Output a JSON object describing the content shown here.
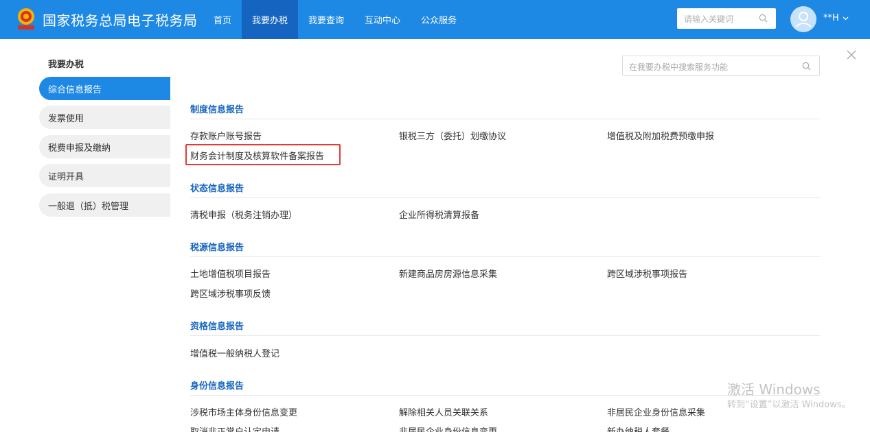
{
  "header": {
    "brand": "国家税务总局电子税务局",
    "nav": [
      {
        "label": "首页"
      },
      {
        "label": "我要办税",
        "active": true
      },
      {
        "label": "我要查询"
      },
      {
        "label": "互动中心"
      },
      {
        "label": "公众服务"
      }
    ],
    "search_placeholder": "请输入关键词",
    "user_name": "**H",
    "accent_color": "#1e88e5"
  },
  "sidebar": {
    "title": "我要办税",
    "items": [
      {
        "label": "综合信息报告",
        "active": true
      },
      {
        "label": "发票使用"
      },
      {
        "label": "税费申报及缴纳"
      },
      {
        "label": "证明开具"
      },
      {
        "label": "一般退（抵）税管理"
      }
    ]
  },
  "main": {
    "search_placeholder": "在我要办税中搜索服务功能",
    "sections": [
      {
        "title": "制度信息报告",
        "items": [
          "存款账户账号报告",
          "银税三方（委托）划缴协议",
          "增值税及附加税费预缴申报",
          "财务会计制度及核算软件备案报告"
        ]
      },
      {
        "title": "状态信息报告",
        "items": [
          "清税申报（税务注销办理）",
          "企业所得税清算报备"
        ]
      },
      {
        "title": "税源信息报告",
        "items": [
          "土地增值税项目报告",
          "新建商品房房源信息采集",
          "跨区域涉税事项报告",
          "跨区域涉税事项反馈"
        ]
      },
      {
        "title": "资格信息报告",
        "items": [
          "增值税一般纳税人登记"
        ]
      },
      {
        "title": "身份信息报告",
        "items": [
          "涉税市场主体身份信息变更",
          "解除相关人员关联关系",
          "非居民企业身份信息采集",
          "取消非正常户认定申请",
          "非居民企业身份信息变更",
          "新办纳税人套餐"
        ]
      }
    ]
  },
  "watermark": {
    "line1": "激活 Windows",
    "line2": "转到“设置”以激活 Windows。"
  }
}
